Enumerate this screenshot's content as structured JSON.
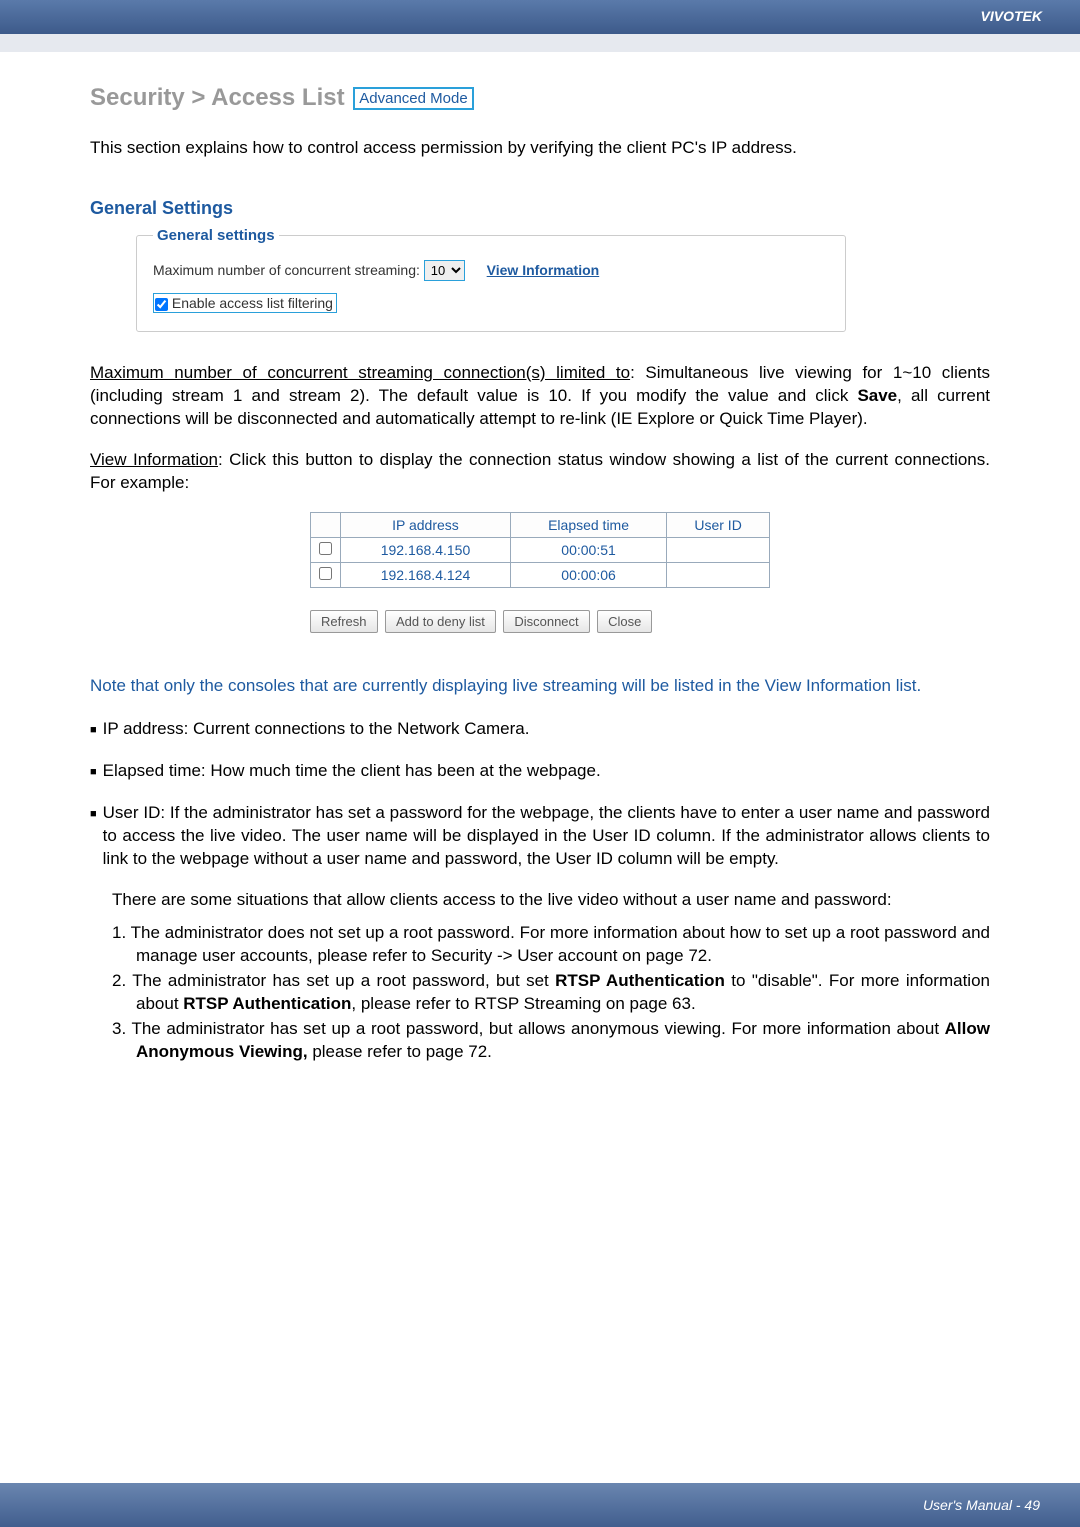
{
  "brand": "VIVOTEK",
  "page_title_prefix": "Security >  Access List",
  "advanced_badge": "Advanced Mode",
  "intro": "This section explains how to control access permission by verifying the client PC's IP address.",
  "general_settings": {
    "heading": "General Settings",
    "legend": "General settings",
    "max_label": "Maximum number of concurrent streaming:",
    "max_value": "10",
    "view_info": "View Information",
    "enable_filter": "Enable access list filtering"
  },
  "para_max": "Maximum number of concurrent streaming connection(s) limited to: Simultaneous live viewing for 1~10 clients (including stream 1 and stream 2). The default value is 10. If you modify the value and click Save, all current connections will be disconnected and automatically attempt to re-link (IE Explore or Quick Time Player).",
  "para_max_underline": "Maximum number of concurrent streaming connection(s) limited to",
  "para_viewinfo_underline": "View Information",
  "para_viewinfo_rest": ": Click this button to display the connection status window showing a list of the current connections. For example:",
  "conn_table": {
    "headers": [
      "IP address",
      "Elapsed time",
      "User ID"
    ],
    "rows": [
      {
        "ip": "192.168.4.150",
        "time": "00:00:51",
        "user": ""
      },
      {
        "ip": "192.168.4.124",
        "time": "00:00:06",
        "user": ""
      }
    ],
    "buttons": {
      "refresh": "Refresh",
      "add_deny": "Add to deny list",
      "disconnect": "Disconnect",
      "close": "Close"
    }
  },
  "note_blue": "Note that only the consoles that are currently displaying live streaming will be listed in the View Information list.",
  "bullet_ip": "IP address: Current connections to the Network Camera.",
  "bullet_elapsed": "Elapsed time: How much time the client has been at the webpage.",
  "bullet_userid": "User ID: If the administrator has set a password for the webpage, the clients have to enter a user name and password to access the live video. The user name will be displayed in the User ID column. If  the administrator allows clients to link to the webpage without a user name and password, the User ID column will be empty.",
  "sub_para": "There are some situations that allow clients access to the live video without a user name and password:",
  "num_items": [
    "1. The administrator does not set up a root password. For more information about how to set up a root password and manage user accounts, please refer to Security -> User account on page 72.",
    "2. The administrator has set up a root password, but set RTSP Authentication to \"disable\". For more information about RTSP Authentication, please refer to RTSP Streaming on page 63.",
    "3. The administrator has set up a root password, but allows anonymous viewing. For more information about Allow Anonymous Viewing, please refer to page 72."
  ],
  "footer": "User's Manual - 49"
}
